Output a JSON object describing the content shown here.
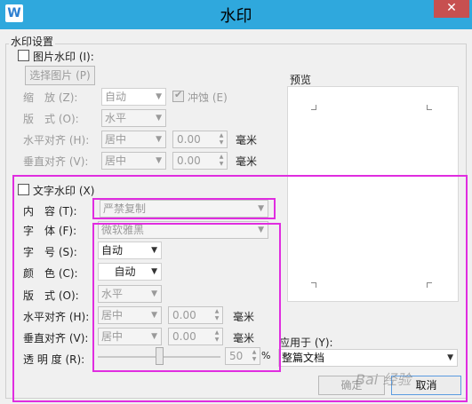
{
  "window": {
    "title": "水印",
    "app_icon": "W",
    "close_symbol": "✕"
  },
  "group_title": "水印设置",
  "picture_watermark": {
    "checkbox_label": "图片水印 (I):",
    "select_button": "选择图片 (P)",
    "scale_label": "缩　放 (Z):",
    "scale_value": "自动",
    "washout_label": "冲蚀 (E)",
    "layout_label": "版　式 (O):",
    "layout_value": "水平",
    "h_align_label": "水平对齐 (H):",
    "h_align_value": "居中",
    "h_offset": "0.00",
    "v_align_label": "垂直对齐 (V):",
    "v_align_value": "居中",
    "v_offset": "0.00",
    "unit": "毫米"
  },
  "preview_label": "预览",
  "text_watermark": {
    "checkbox_label": "文字水印 (X)",
    "content_label": "内　容 (T):",
    "content_value": "严禁复制",
    "font_label": "字　体 (F):",
    "font_value": "微软雅黑",
    "size_label": "字　号 (S):",
    "size_value": "自动",
    "color_label": "颜　色 (C):",
    "color_value": "自动",
    "layout_label": "版　式 (O):",
    "layout_value": "水平",
    "h_align_label": "水平对齐 (H):",
    "h_align_value": "居中",
    "h_offset": "0.00",
    "v_align_label": "垂直对齐 (V):",
    "v_align_value": "居中",
    "v_offset": "0.00",
    "unit": "毫米",
    "transparency_label": "透 明 度 (R):",
    "transparency_value": "50",
    "percent": "%"
  },
  "apply_to": {
    "label": "应用于 (Y):",
    "value": "整篇文档"
  },
  "buttons": {
    "ok": "确定",
    "cancel": "取消"
  },
  "site_watermark": "Bai 经验",
  "colors": {
    "titlebar": "#2fa8dd",
    "close": "#c75050",
    "highlight": "#e02de0"
  }
}
